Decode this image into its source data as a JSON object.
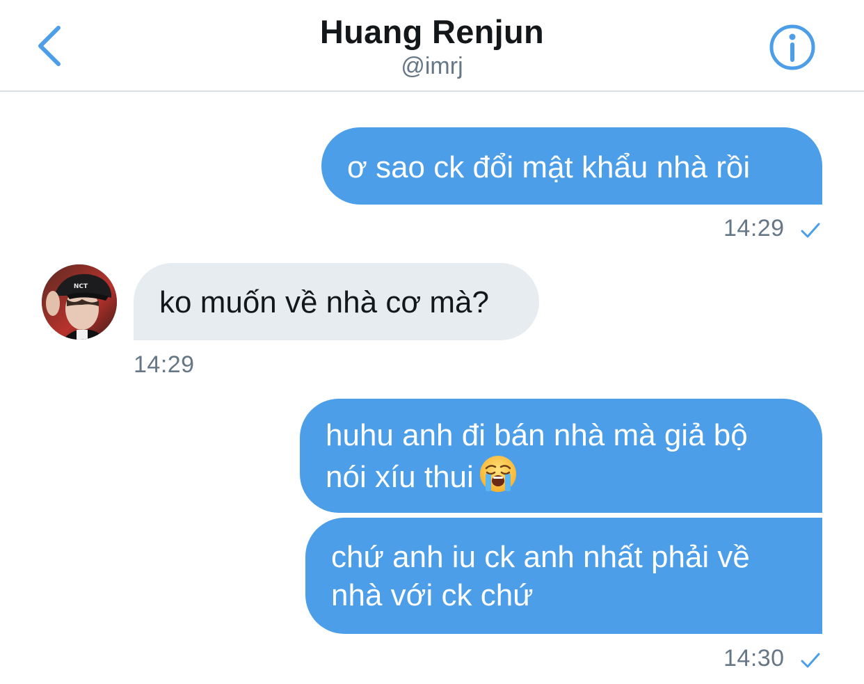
{
  "header": {
    "back_icon": "chevron-left-icon",
    "title": "Huang Renjun",
    "handle": "@imrj",
    "info_icon": "info-icon"
  },
  "colors": {
    "accent": "#4c9ee8",
    "incoming_bubble": "#e6ecf0",
    "text": "#14171a",
    "secondary_text": "#657786",
    "divider": "#d8dde1"
  },
  "messages": [
    {
      "direction": "outgoing",
      "text": "ơ sao ck đổi mật khẩu nhà rồi"
    },
    {
      "direction": "incoming",
      "text": "ko muốn về nhà cơ mà?"
    },
    {
      "direction": "outgoing",
      "line1": "huhu anh đi bán nhà mà giả bộ",
      "line2": "nói xíu thui",
      "emoji": "loudly-crying-face-emoji"
    },
    {
      "direction": "outgoing",
      "line1": "chứ anh iu ck anh nhất phải về",
      "line2": "nhà với ck chứ"
    }
  ],
  "timestamps": [
    {
      "time": "14:29",
      "status_icon": "check-icon"
    },
    {
      "time": "14:29"
    },
    {
      "time": "14:30",
      "status_icon": "check-icon"
    }
  ],
  "avatar_icon": "user-avatar"
}
